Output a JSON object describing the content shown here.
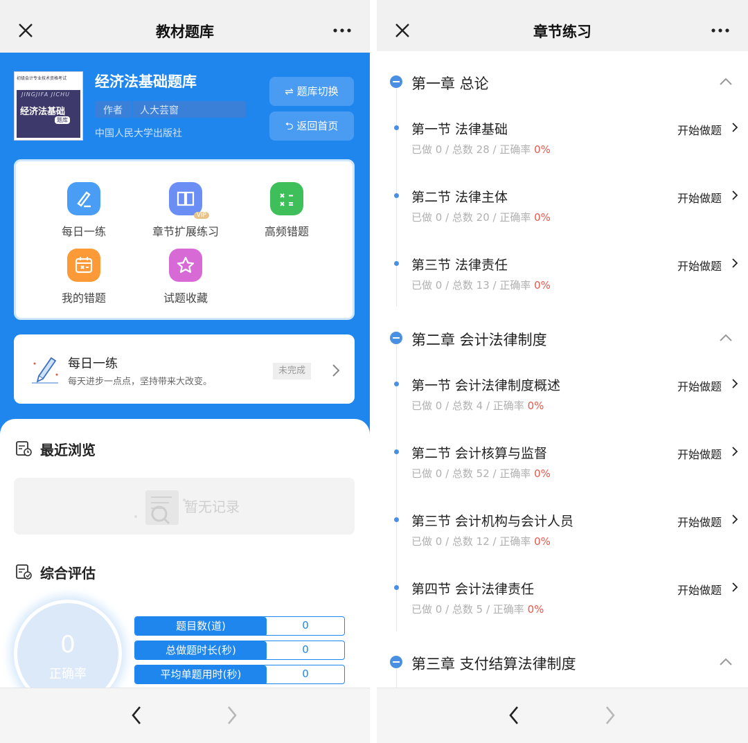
{
  "left": {
    "title": "教材题库",
    "book": {
      "cover_header": "初级会计专业技术资格考试",
      "cover_pinyin": "JINGJIFA JICHU",
      "cover_name": "经济法基础",
      "cover_tag": "题库",
      "title": "经济法基础题库",
      "author_label": "作者",
      "author": "人大芸窗",
      "publisher": "中国人民大学出版社"
    },
    "buttons": {
      "switch": "⇌ 题库切换",
      "home": "⮌ 返回首页"
    },
    "features": [
      {
        "label": "每日一练",
        "icon": "pen-icon",
        "color": "#4a9df5"
      },
      {
        "label": "章节扩展练习",
        "icon": "book-icon",
        "color": "#6b8ef5",
        "badge": "VIP"
      },
      {
        "label": "高频错题",
        "icon": "calculator-icon",
        "color": "#3fbf5a"
      },
      {
        "label": "我的错题",
        "icon": "calendar-x-icon",
        "color": "#fb9a37"
      },
      {
        "label": "试题收藏",
        "icon": "star-icon",
        "color": "#d86ad6"
      }
    ],
    "daily": {
      "title": "每日一练",
      "subtitle": "每天进步一点点，坚持带来大改变。",
      "status": "未完成"
    },
    "recent": {
      "title": "最近浏览",
      "empty": "暂无记录"
    },
    "evaluation": {
      "title": "综合评估",
      "accuracy_value": "0",
      "accuracy_label": "正确率",
      "stats": [
        {
          "label": "题目数(道)",
          "value": "0"
        },
        {
          "label": "总做题时长(秒)",
          "value": "0"
        },
        {
          "label": "平均单题用时(秒)",
          "value": "0"
        }
      ]
    }
  },
  "right": {
    "title": "章节练习",
    "start_label": "开始做题",
    "chapters": [
      {
        "title": "第一章  总论",
        "sections": [
          {
            "title": "第一节  法律基础",
            "stats": "已做 0 / 总数 28 / 正确率 ",
            "pct": "0%"
          },
          {
            "title": "第二节  法律主体",
            "stats": "已做 0 / 总数 20 / 正确率 ",
            "pct": "0%"
          },
          {
            "title": "第三节  法律责任",
            "stats": "已做 0 / 总数 13 / 正确率 ",
            "pct": "0%"
          }
        ]
      },
      {
        "title": "第二章  会计法律制度",
        "sections": [
          {
            "title": "第一节  会计法律制度概述",
            "stats": "已做 0 / 总数 4 / 正确率 ",
            "pct": "0%"
          },
          {
            "title": "第二节  会计核算与监督",
            "stats": "已做 0 / 总数 52 / 正确率 ",
            "pct": "0%"
          },
          {
            "title": "第三节  会计机构与会计人员",
            "stats": "已做 0 / 总数 12 / 正确率 ",
            "pct": "0%"
          },
          {
            "title": "第四节  会计法律责任",
            "stats": "已做 0 / 总数 5 / 正确率 ",
            "pct": "0%"
          }
        ]
      },
      {
        "title": "第三章  支付结算法律制度",
        "sections": []
      }
    ]
  },
  "colors": {
    "primary": "#1f86ee",
    "accent_red": "#e8574a"
  }
}
